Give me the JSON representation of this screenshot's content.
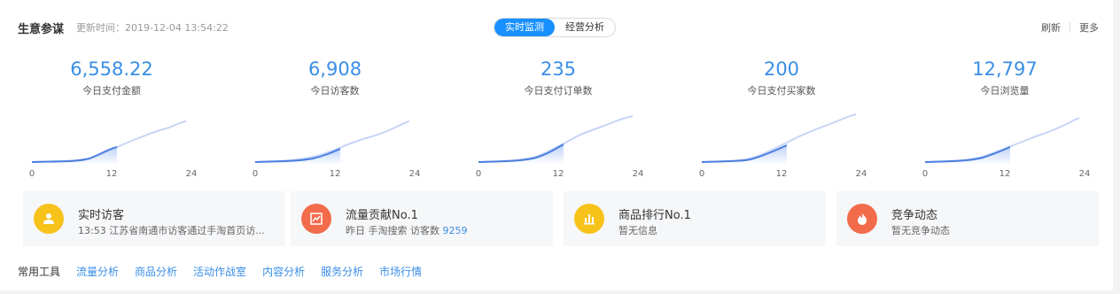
{
  "header": {
    "title": "生意参谋",
    "update_time": "更新时间：2019-12-04 13:54:22",
    "tabs": [
      "实时监测",
      "经营分析"
    ],
    "refresh_label": "刷新",
    "more_label": "更多"
  },
  "metrics": [
    {
      "value": "6,558.22",
      "label": "今日支付金额"
    },
    {
      "value": "6,908",
      "label": "今日访客数"
    },
    {
      "value": "235",
      "label": "今日支付订单数"
    },
    {
      "value": "200",
      "label": "今日支付买家数"
    },
    {
      "value": "12,797",
      "label": "今日浏览量"
    }
  ],
  "axis_ticks": [
    "0",
    "12",
    "24"
  ],
  "cards": [
    {
      "title": "实时访客",
      "sub_prefix": "13:53 江苏省南通市访客通过手淘首页访...",
      "sub_num": "",
      "icon": "user-icon",
      "color": "#f7c21a"
    },
    {
      "title": "流量贡献No.1",
      "sub_prefix": "昨日 手淘搜索 访客数 ",
      "sub_num": "9259",
      "icon": "trend-icon",
      "color": "#f26b4b"
    },
    {
      "title": "商品排行No.1",
      "sub_prefix": "暂无信息",
      "sub_num": "",
      "icon": "bar-chart-icon",
      "color": "#f7c21a"
    },
    {
      "title": "竞争动态",
      "sub_prefix": "暂无竞争动态",
      "sub_num": "",
      "icon": "flame-icon",
      "color": "#f26b4b"
    }
  ],
  "tools": {
    "title": "常用工具",
    "links": [
      "流量分析",
      "商品分析",
      "活动作战室",
      "内容分析",
      "服务分析",
      "市场行情"
    ]
  }
}
